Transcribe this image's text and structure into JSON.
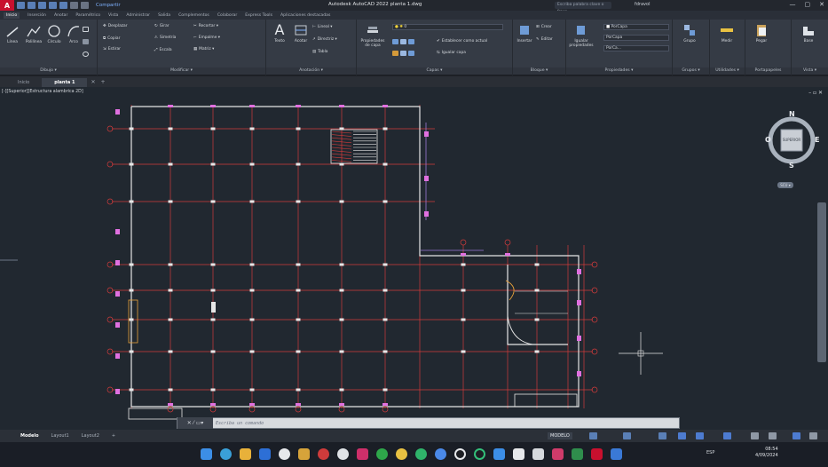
{
  "titlebar": {
    "logo": "A",
    "share": "Compartir",
    "title": "Autodesk AutoCAD 2022   planta 1.dwg",
    "search_placeholder": "Escriba palabra clave o frase",
    "user": "fdravol",
    "window_controls": [
      "—",
      "▢",
      "✕"
    ]
  },
  "ribbon_tabs": [
    "Inicio",
    "Inserción",
    "Anotar",
    "Paramétrico",
    "Vista",
    "Administrar",
    "Salida",
    "Complementos",
    "Colaborar",
    "Express Tools",
    "Aplicaciones destacadas"
  ],
  "ribbon": {
    "draw": {
      "label": "Dibujo ▾",
      "line": "Línea",
      "polyline": "Polilínea",
      "circle": "Círculo",
      "arc": "Arco"
    },
    "modify": {
      "label": "Modificar ▾",
      "move": "Desplazar",
      "rotate": "Girar",
      "trim": "Recortar ▾",
      "copy": "Copiar",
      "mirror": "Simetría",
      "fillet": "Empalme ▾",
      "stretch": "Estirar",
      "scale": "Escala",
      "array": "Matriz ▾"
    },
    "annotation": {
      "label": "Anotación ▾",
      "text": "Texto",
      "dimension": "Acotar",
      "linear": "Lineal ▾",
      "leader": "Directriz ▾",
      "table": "Tabla"
    },
    "layers": {
      "label": "Capas ▾",
      "properties": "Propiedades de capa",
      "layer_value": "0",
      "make_current": "Establecer como actual",
      "match": "Igualar capa"
    },
    "block": {
      "label": "Bloque ▾",
      "insert": "Insertar",
      "create": "Crear",
      "edit": "Editar"
    },
    "properties": {
      "label": "Propiedades ▾",
      "match": "Igualar propiedades",
      "color": "PorCapa",
      "linetype": "PorCapa",
      "lineweight": "PorCa..."
    },
    "groups": {
      "label": "Grupos ▾",
      "group": "Grupo"
    },
    "utilities": {
      "label": "Utilidades ▾",
      "measure": "Medir"
    },
    "clipboard": {
      "label": "Portapapeles",
      "paste": "Pegar"
    },
    "view": {
      "label": "Vista ▾",
      "base": "Base"
    }
  },
  "doc_tabs": {
    "home": "Inicio",
    "active": "planta 1",
    "close": "✕",
    "add": "+"
  },
  "viewport": {
    "label": "[-][Superior][Estructura alambrica 2D]",
    "controls": "– ▫ ✕",
    "viewcube": {
      "n": "N",
      "s": "S",
      "e": "E",
      "w": "O",
      "face": "SUPERIOR"
    },
    "wcs": "SCU ▾"
  },
  "command": {
    "icons": "✕ ⁄ ▭▾",
    "placeholder": "Escriba un comando"
  },
  "layout_tabs": [
    "Modelo",
    "Layout1",
    "Layout2",
    "+"
  ],
  "status": {
    "model": "MODELO"
  },
  "tray": {
    "lang": "ESP",
    "time": "08:54",
    "date": "4/09/2024"
  },
  "colors": {
    "grid_red": "#d23b3b",
    "wall_white": "#e6e6e6",
    "magenta": "#e070e0",
    "purple": "#9b7ad8",
    "background": "#212830"
  }
}
